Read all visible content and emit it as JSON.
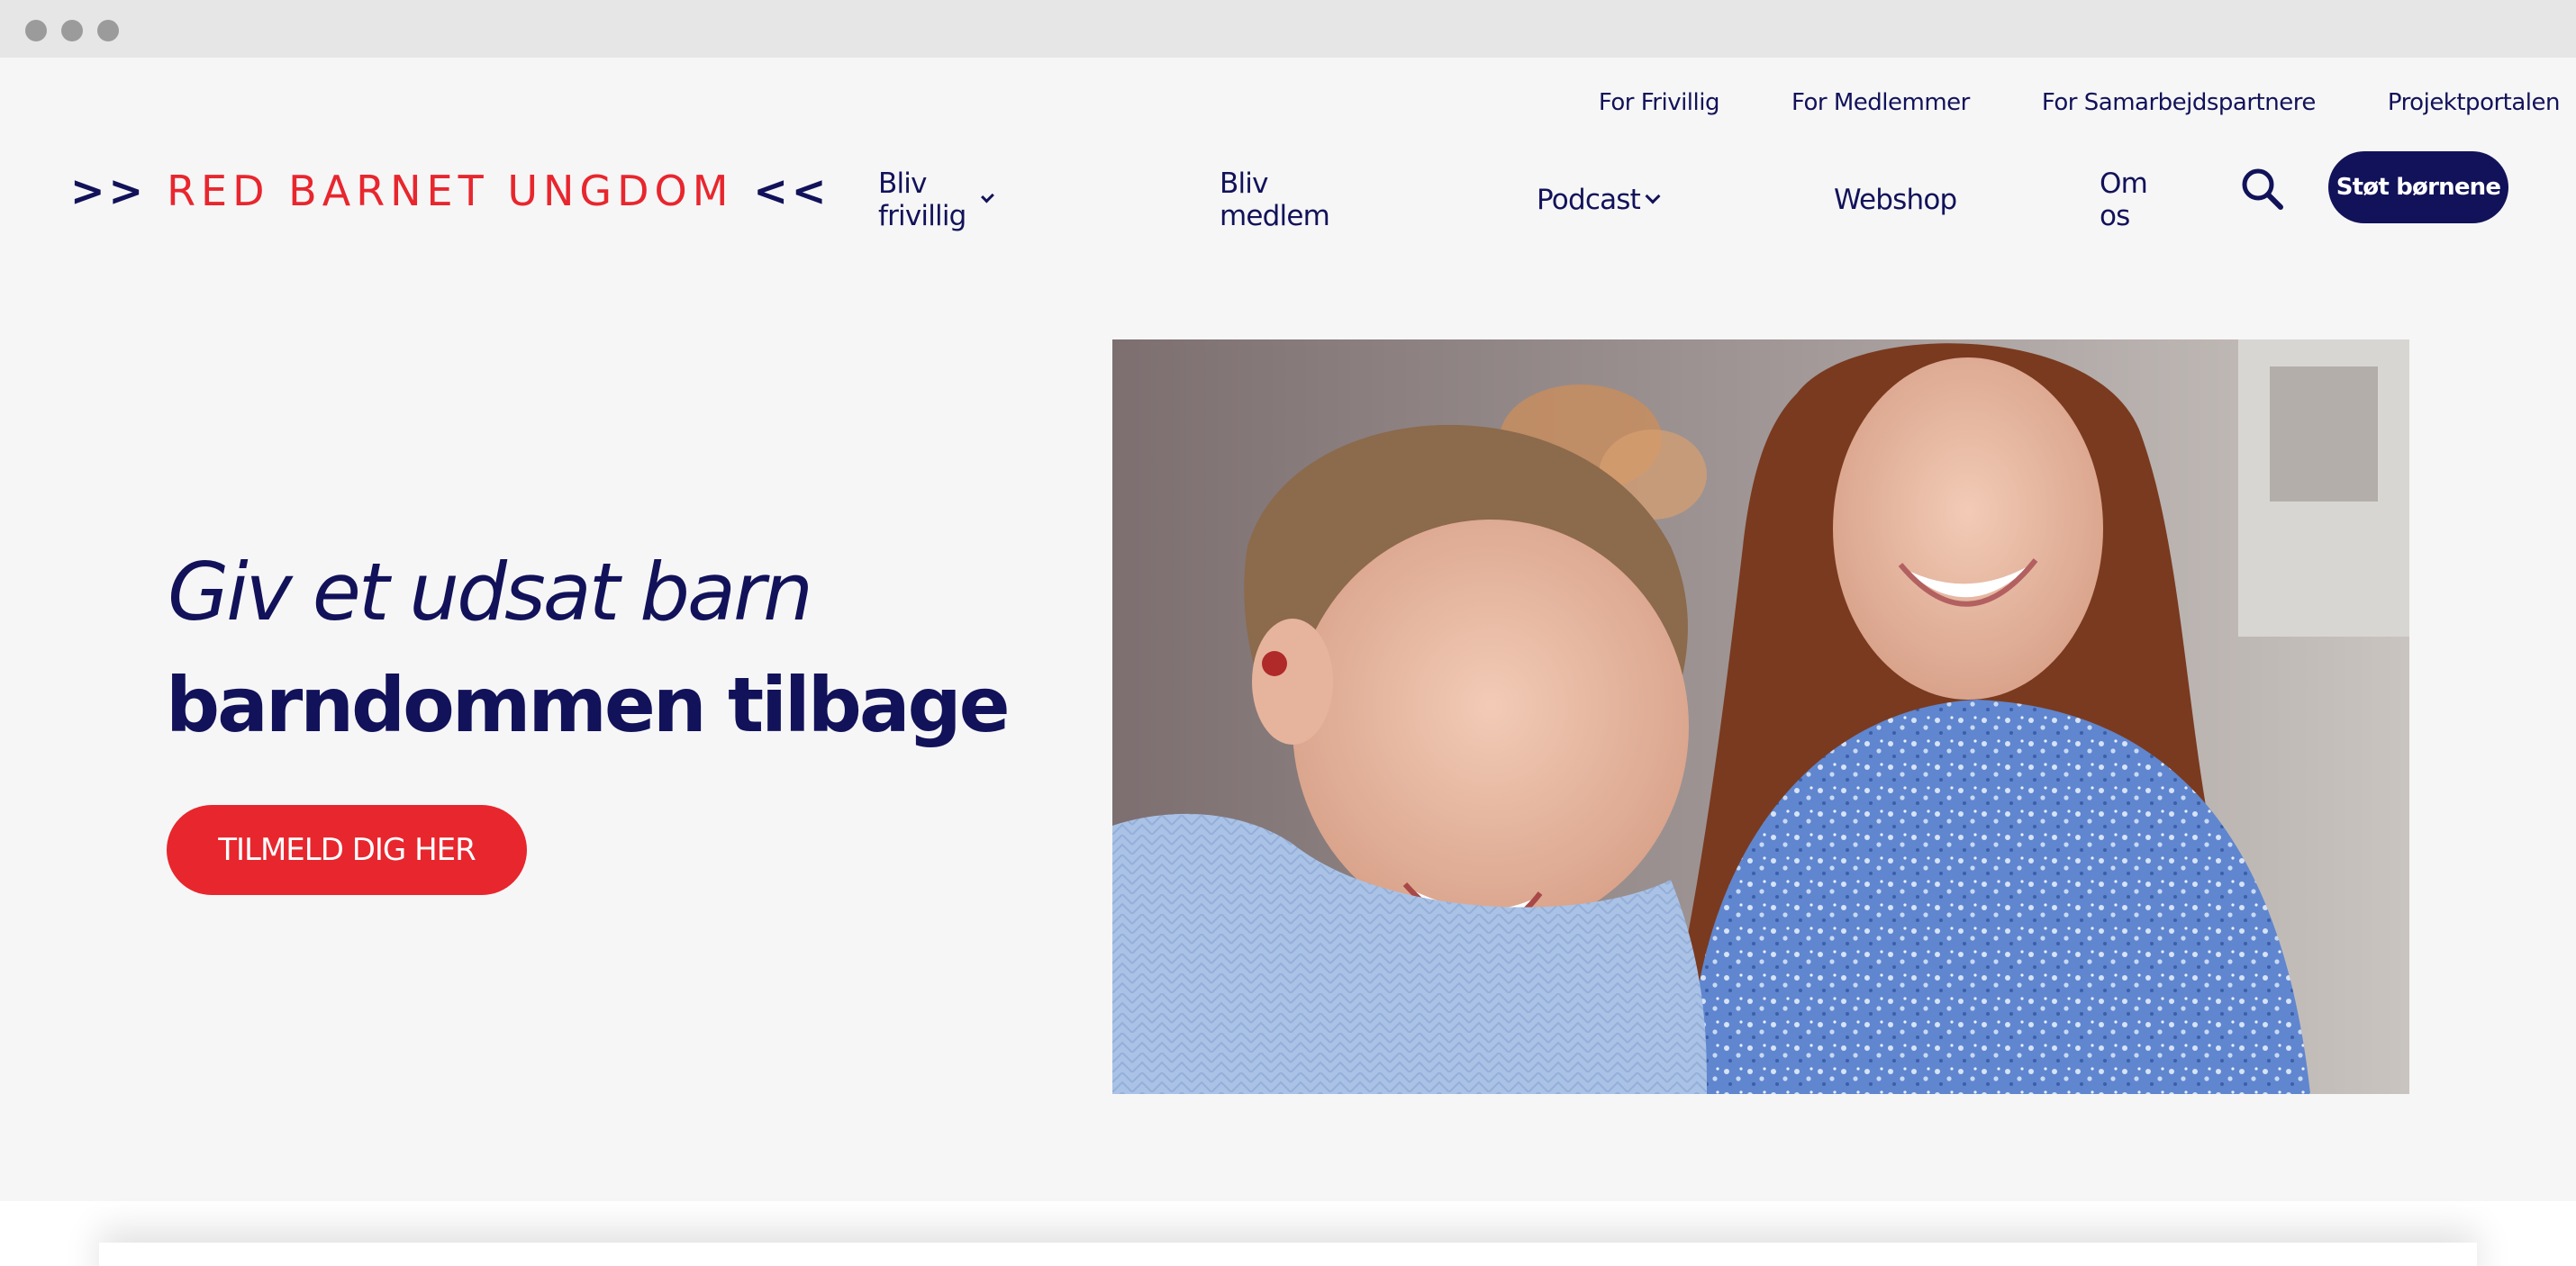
{
  "utility_nav": [
    "For Frivillig",
    "For Medlemmer",
    "For Samarbejdspartnere",
    "Projektportalen"
  ],
  "logo": {
    "left": ">>",
    "name": "RED BARNET UNGDOM",
    "right": "<<"
  },
  "main_nav": {
    "volunteer": "Bliv frivillig",
    "member": "Bliv medlem",
    "podcast": "Podcast",
    "webshop": "Webshop",
    "about": "Om os"
  },
  "donate_label": "Støt børnene",
  "hero": {
    "line1": "Giv et udsat barn",
    "line2": "barndommen tilbage",
    "cta": "TILMELD DIG HER"
  },
  "colors": {
    "navy": "#12125a",
    "red": "#e8262e",
    "background": "#f6f6f6"
  },
  "icons": [
    "search-icon",
    "chevron-down-icon"
  ]
}
